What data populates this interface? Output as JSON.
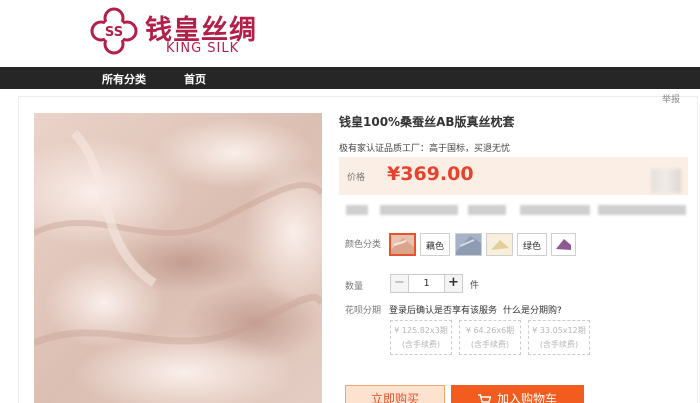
{
  "brand": {
    "name_cn": "钱皇丝绸",
    "name_en": "KING SILK"
  },
  "nav": {
    "items": [
      "所有分类",
      "首页"
    ]
  },
  "report_link": "举报",
  "product": {
    "title": "钱皇100%桑蚕丝AB版真丝枕套",
    "subtitle": "极有家认证品质工厂：高于国标，买退无忧",
    "price_label": "价格",
    "price": "¥369.00",
    "color_label": "颜色分类",
    "colors": [
      {
        "label": "",
        "type": "image",
        "selected": true,
        "color": "#d9a58c"
      },
      {
        "label": "藕色",
        "type": "text",
        "selected": false
      },
      {
        "label": "",
        "type": "image",
        "selected": false,
        "color": "#8e9cb3"
      },
      {
        "label": "",
        "type": "image",
        "selected": false,
        "color": "#e3cf9c"
      },
      {
        "label": "绿色",
        "type": "text",
        "selected": false
      },
      {
        "label": "",
        "type": "image",
        "selected": false,
        "color": "#8c5a8e"
      }
    ],
    "qty_label": "数量",
    "qty_value": "1",
    "qty_minus": "−",
    "qty_plus": "+",
    "qty_unit": "件",
    "installment_label": "花呗分期",
    "installment_login": "登录后确认是否享有该服务",
    "installment_what": "什么是分期购?",
    "installments": [
      {
        "line1": "¥ 125.82x3期",
        "line2": "(含手续费)"
      },
      {
        "line1": "¥ 64.26x6期",
        "line2": "(含手续费)"
      },
      {
        "line1": "¥ 33.05x12期",
        "line2": "(含手续费)"
      }
    ],
    "buy_now": "立即购买",
    "add_cart": "加入购物车"
  },
  "colors": {
    "brand": "#b2204a",
    "accent": "#e8412c",
    "nav_bg": "#262626",
    "price_bg": "#fbeee4"
  }
}
